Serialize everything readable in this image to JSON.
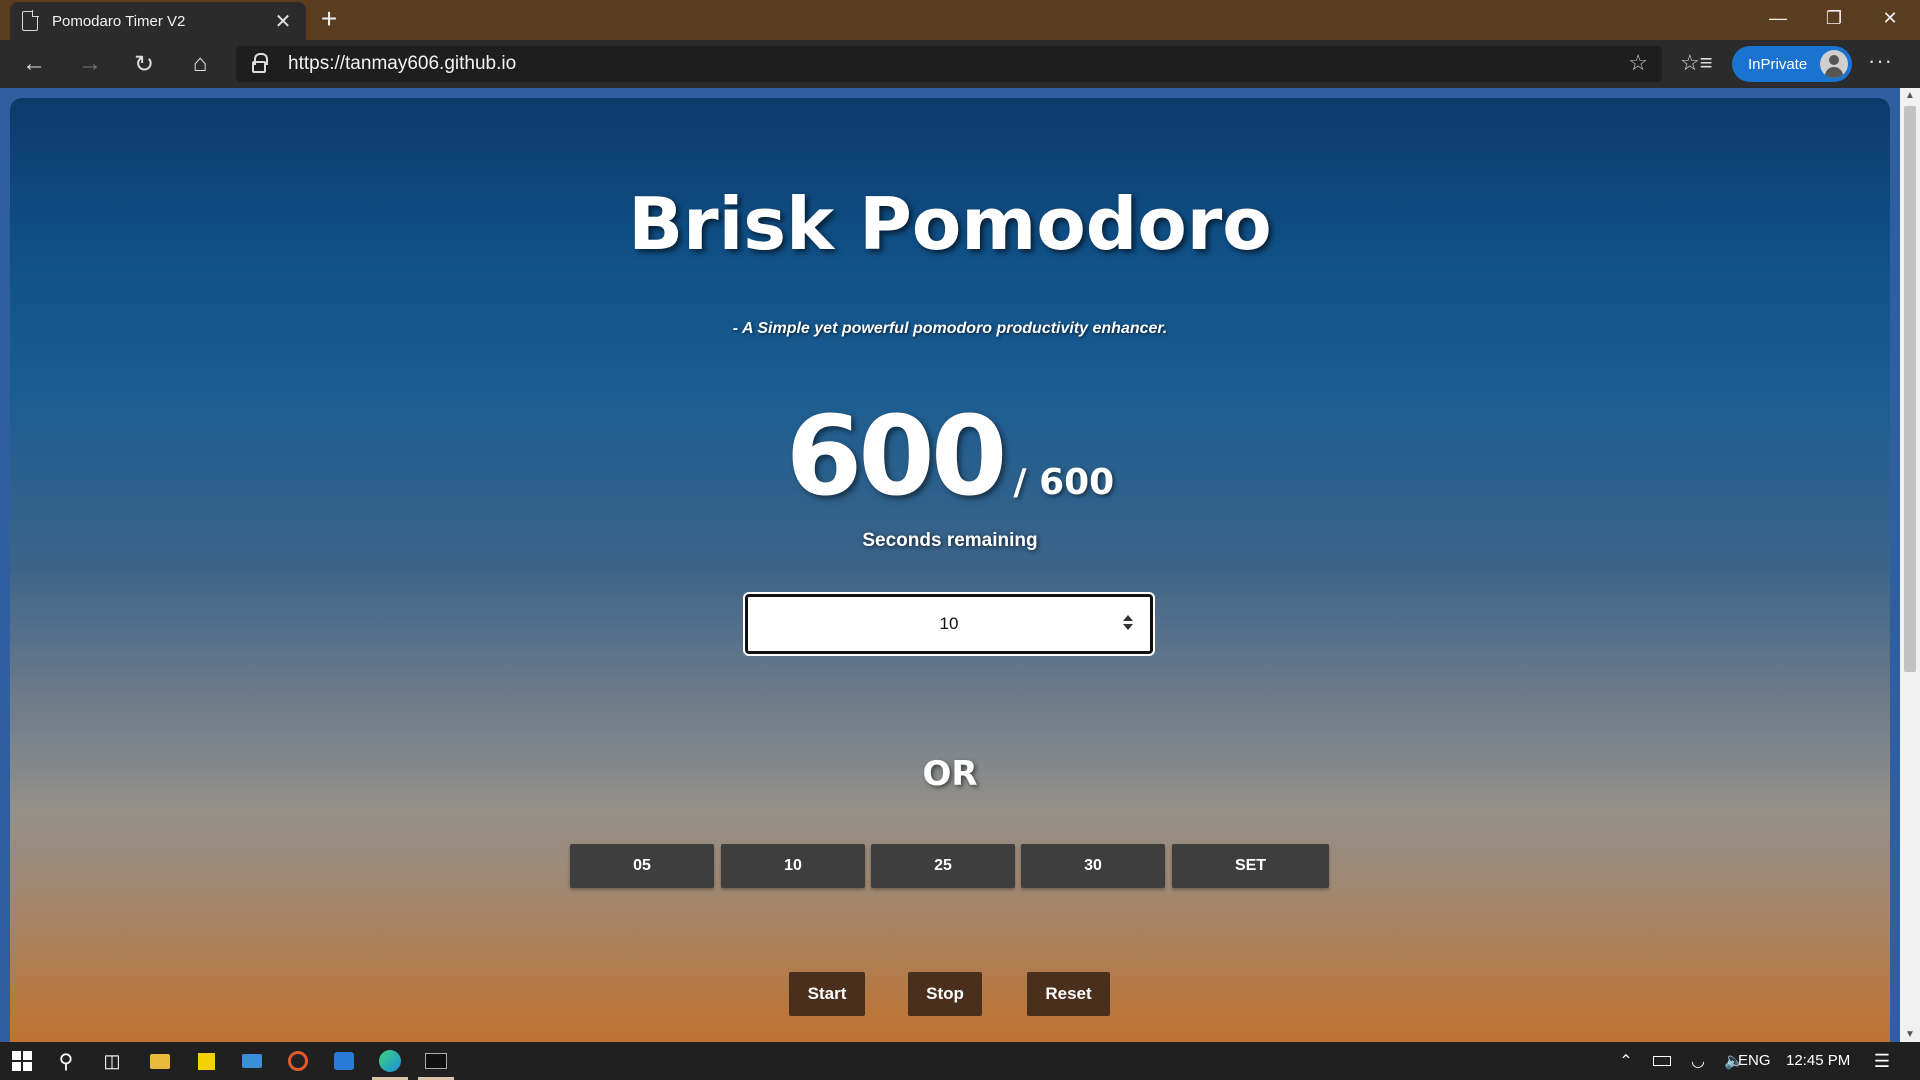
{
  "browser": {
    "tab_title": "Pomodaro Timer V2",
    "tab_close": "✕",
    "new_tab": "+",
    "url": "https://tanmay606.github.io",
    "inprivate_label": "InPrivate",
    "accent_color": "#1a73d1"
  },
  "app": {
    "title": "Brisk Pomodoro",
    "tagline": "- A Simple yet powerful pomodoro productivity enhancer.",
    "timer_remaining": "600",
    "timer_total": "/ 600",
    "seconds_label": "Seconds remaining",
    "minutes_input_value": "10",
    "or_label": "OR",
    "presets": [
      "05",
      "10",
      "25",
      "30"
    ],
    "set_label": "SET",
    "start_label": "Start",
    "stop_label": "Stop",
    "reset_label": "Reset"
  },
  "taskbar": {
    "language": "ENG",
    "time": "12:45 PM"
  }
}
